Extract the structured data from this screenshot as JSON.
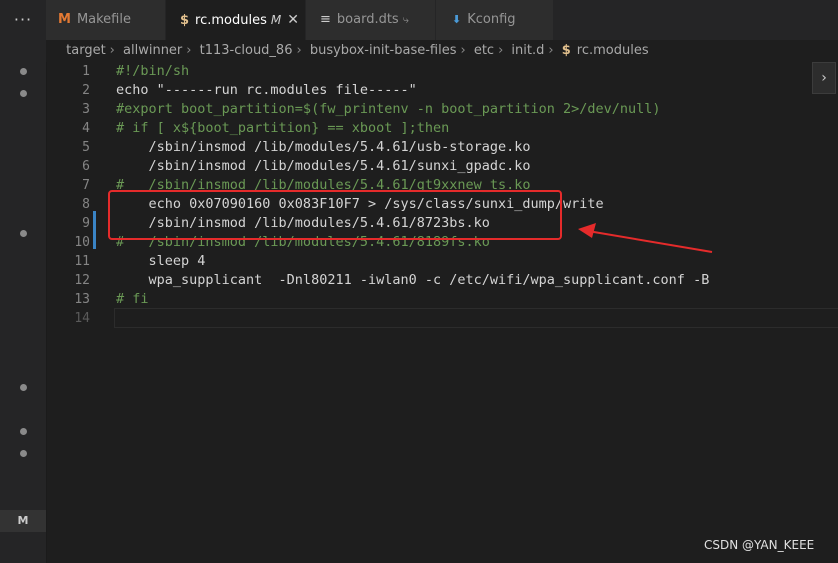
{
  "tabs": [
    {
      "icon": "M",
      "label": "Makefile",
      "active": false
    },
    {
      "icon": "$",
      "label": "rc.modules",
      "modified": "M",
      "active": true
    },
    {
      "icon": "≡",
      "label": "board.dts",
      "tag": "⤷",
      "active": false
    },
    {
      "icon": "⬇",
      "label": "Kconfig",
      "active": false
    }
  ],
  "breadcrumb": [
    "target",
    "allwinner",
    "t113-cloud_86",
    "busybox-init-base-files",
    "etc",
    "init.d",
    "rc.modules"
  ],
  "editor": {
    "lines": [
      {
        "n": "1",
        "text": "#!/bin/sh"
      },
      {
        "n": "2",
        "text": "echo \"------run rc.modules file-----\""
      },
      {
        "n": "3",
        "text": "#export boot_partition=$(fw_printenv -n boot_partition 2>/dev/null)"
      },
      {
        "n": "4",
        "text": "# if [ x${boot_partition} == xboot ];then"
      },
      {
        "n": "5",
        "text": "    /sbin/insmod /lib/modules/5.4.61/usb-storage.ko"
      },
      {
        "n": "6",
        "text": "    /sbin/insmod /lib/modules/5.4.61/sunxi_gpadc.ko"
      },
      {
        "n": "7",
        "text": "#   /sbin/insmod /lib/modules/5.4.61/gt9xxnew_ts.ko"
      },
      {
        "n": "8",
        "text": "    echo 0x07090160 0x083F10F7 > /sys/class/sunxi_dump/write"
      },
      {
        "n": "9",
        "text": "    /sbin/insmod /lib/modules/5.4.61/8723bs.ko"
      },
      {
        "n": "10",
        "text": "#   /sbin/insmod /lib/modules/5.4.61/8189fs.ko"
      },
      {
        "n": "11",
        "text": "    sleep 4"
      },
      {
        "n": "12",
        "text": "    wpa_supplicant  -Dnl80211 -iwlan0 -c /etc/wifi/wpa_supplicant.conf -B"
      },
      {
        "n": "13",
        "text": "# fi"
      },
      {
        "n": "14",
        "text": ""
      }
    ]
  },
  "activity": {
    "badge": "M"
  },
  "watermark": "CSDN @YAN_KEEE",
  "colors": {
    "annotation": "#e52b2b",
    "comment": "#6a9955",
    "string": "#ce9178",
    "option": "#569cd6",
    "modified_bar": "#3a84c5"
  }
}
